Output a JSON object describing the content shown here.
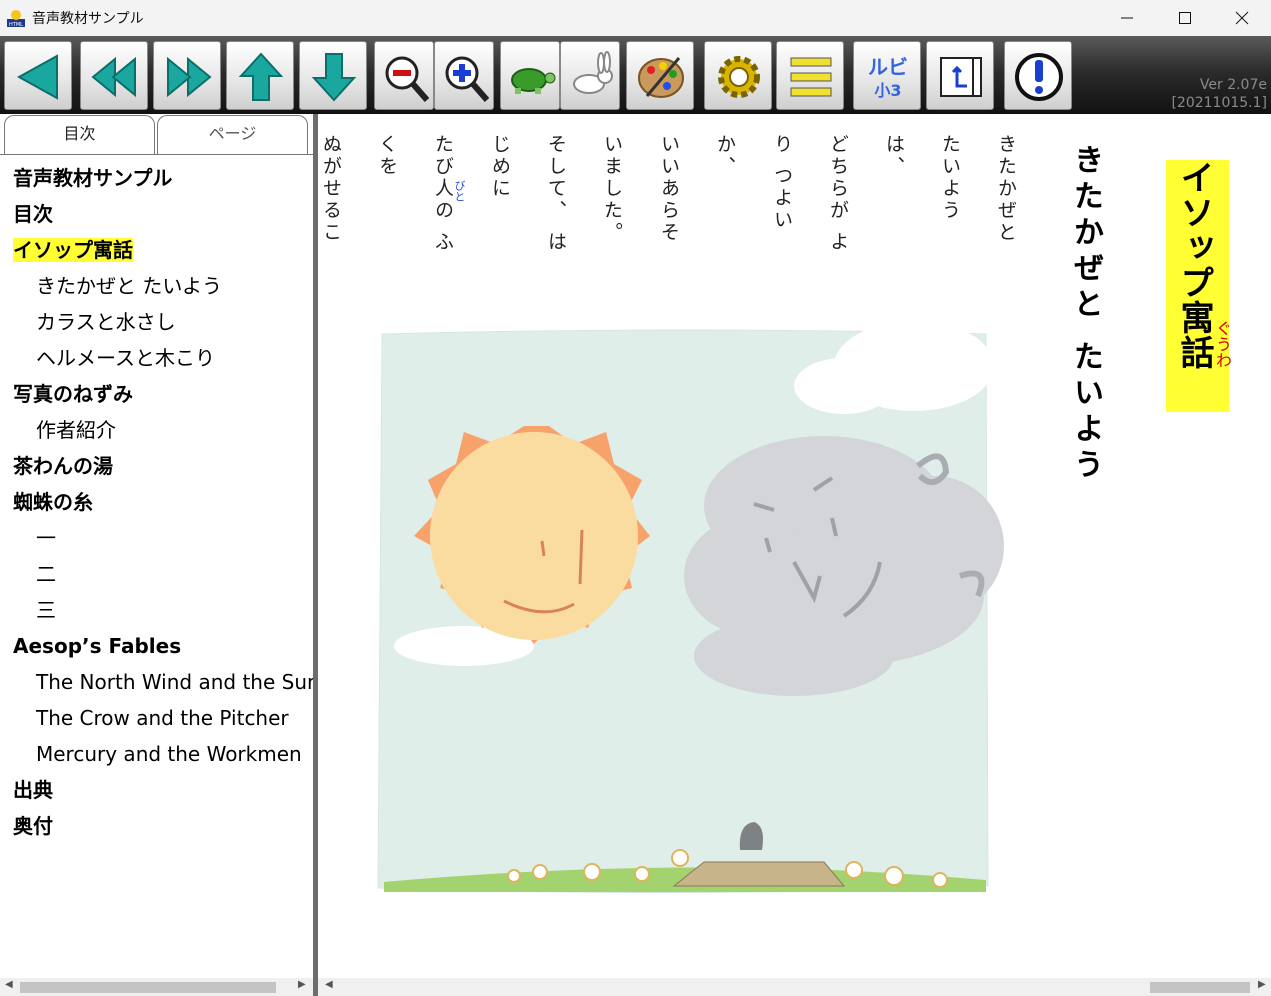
{
  "window": {
    "title": "音声教材サンプル"
  },
  "toolbar": {
    "buttons": [
      {
        "name": "prev-page-button",
        "icon": "arrow-left-icon"
      },
      {
        "name": "prev-chapter-button",
        "icon": "double-arrow-left-icon"
      },
      {
        "name": "next-chapter-button",
        "icon": "double-arrow-right-icon"
      },
      {
        "name": "previous-button",
        "icon": "arrow-up-icon"
      },
      {
        "name": "next-button",
        "icon": "arrow-down-icon"
      },
      {
        "name": "zoom-out-button",
        "icon": "zoom-out-icon"
      },
      {
        "name": "zoom-in-button",
        "icon": "zoom-in-icon"
      },
      {
        "name": "slower-button",
        "icon": "turtle-icon"
      },
      {
        "name": "faster-button",
        "icon": "rabbit-icon"
      },
      {
        "name": "color-settings-button",
        "icon": "palette-icon"
      },
      {
        "name": "settings-button",
        "icon": "gear-icon"
      },
      {
        "name": "menu-button",
        "icon": "menu-icon"
      },
      {
        "name": "ruby-button",
        "icon": "ruby-icon"
      },
      {
        "name": "return-button",
        "icon": "return-icon"
      },
      {
        "name": "info-button",
        "icon": "info-icon"
      }
    ],
    "ruby_label_top": "ルビ",
    "ruby_label_bottom": "小3",
    "version": "Ver 2.07e",
    "build": "[20211015.1]"
  },
  "sidebar": {
    "tabs": [
      {
        "label": "目次",
        "active": true
      },
      {
        "label": "ページ",
        "active": false
      }
    ],
    "toc": [
      {
        "label": "音声教材サンプル",
        "level": 0
      },
      {
        "label": "目次",
        "level": 0
      },
      {
        "label": "イソップ寓話",
        "level": 0,
        "highlighted": true
      },
      {
        "label": "きたかぜと たいよう",
        "level": 1
      },
      {
        "label": "カラスと水さし",
        "level": 1
      },
      {
        "label": "ヘルメースと木こり",
        "level": 1
      },
      {
        "label": "写真のねずみ",
        "level": 0
      },
      {
        "label": "作者紹介",
        "level": 1
      },
      {
        "label": "茶わんの湯",
        "level": 0
      },
      {
        "label": "蜘蛛の糸",
        "level": 0
      },
      {
        "label": "一",
        "level": 1
      },
      {
        "label": "二",
        "level": 1
      },
      {
        "label": "三",
        "level": 1
      },
      {
        "label": "Aesop’s Fables",
        "level": 0
      },
      {
        "label": "The North Wind and the Sun",
        "level": 1
      },
      {
        "label": "The Crow and the Pitcher",
        "level": 1
      },
      {
        "label": "Mercury and the Workmen",
        "level": 1
      },
      {
        "label": "出典",
        "level": 0
      },
      {
        "label": "奥付",
        "level": 0
      }
    ]
  },
  "content": {
    "book_title": "イソップ寓話",
    "book_title_ruby": "ぐうわ",
    "chapter_title": "きたかぜと たいよう",
    "columns": [
      "きたかぜと",
      "たいよう",
      "は、",
      "どちらが よ",
      "り つよい",
      "か、",
      "いいあらそ",
      "いました。",
      "そして、 は",
      "じめに",
      "たび人の ふ",
      "くを",
      "ぬがせるこ"
    ],
    "column_ruby": "びと"
  },
  "colors": {
    "highlight": "#ffff33",
    "ruby_red": "#d00000",
    "ruby_blue": "#2a4fd1",
    "toolbar_bg": "#1a1a1a"
  }
}
